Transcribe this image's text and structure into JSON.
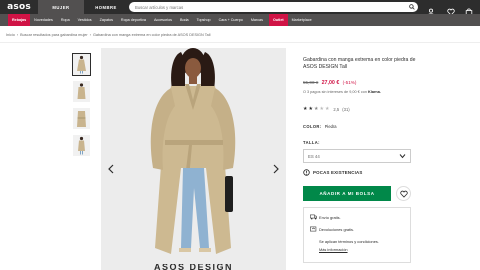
{
  "header": {
    "logo": "asos",
    "gender_tabs": [
      "MUJER",
      "HOMBRE"
    ],
    "search_placeholder": "Buscar artículos y marcas"
  },
  "categories": [
    "Rebajas",
    "Novedades",
    "Ropa",
    "Vestidos",
    "Zapatos",
    "Ropa deportiva",
    "Accesorios",
    "Boda",
    "Topshop",
    "Cara + Cuerpo",
    "Marcas",
    "Outlet",
    "Marketplace"
  ],
  "breadcrumb": [
    "Inicio",
    "Buscar resultados para gabardina mujer",
    "Gabardina con manga extrema en color piedra de ASOS DESIGN Tall"
  ],
  "product": {
    "title": "Gabardina con manga extrema en color piedra de ASOS DESIGN Tall",
    "old_price": "55,00 €",
    "new_price": "27,00 €",
    "discount": "(-51%)",
    "klarna_prefix": "O 3 pagos sin intereses de 9,00 € con",
    "klarna_brand": "Klarna.",
    "rating_value": 2.5,
    "rating_text": "2,5",
    "rating_count": "(31)",
    "color_label": "COLOR:",
    "color_value": "Piedra",
    "size_label": "TALLA:",
    "size_value": "ES 44",
    "stock_label": "POCAS EXISTENCIAS",
    "add_to_bag": "AÑADIR A MI BOLSA",
    "shipping": [
      "Envío gratis.",
      "Devoluciones gratis."
    ],
    "terms": "Se aplican términos y condiciones.",
    "more_info": "Más información"
  },
  "bottom_caption": "ASOS DESIGN",
  "colors": {
    "dark": "#2d2d2d",
    "category_bar": "#525050",
    "sale_red": "#d01345",
    "add_green": "#018849"
  },
  "icons": [
    "search-icon",
    "user-icon",
    "heart-icon",
    "bag-icon",
    "chevron-left-icon",
    "chevron-right-icon",
    "chevron-down-icon",
    "stock-icon",
    "truck-icon",
    "return-icon"
  ]
}
